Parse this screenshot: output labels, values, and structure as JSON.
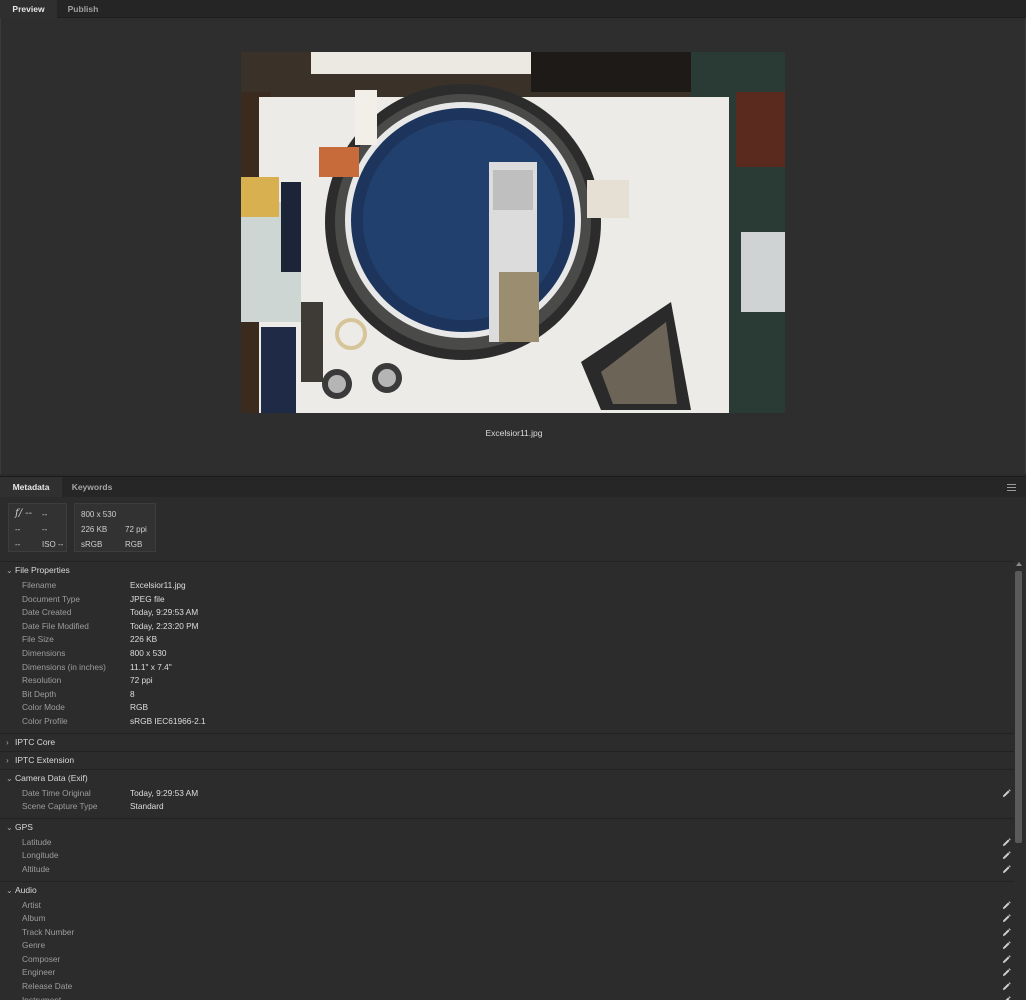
{
  "tabs": [
    {
      "label": "Preview",
      "active": true
    },
    {
      "label": "Publish",
      "active": false
    }
  ],
  "preview": {
    "caption": "Excelsior11.jpg"
  },
  "panel_tabs": [
    {
      "label": "Metadata",
      "active": true
    },
    {
      "label": "Keywords",
      "active": false
    }
  ],
  "camera_summary": {
    "aperture": "f/ --",
    "shutter": "--",
    "r2c1": "--",
    "r2c2": "--",
    "r3c1": "--",
    "iso": "ISO --"
  },
  "image_summary": {
    "dimensions": "800 x 530",
    "size": "226 KB",
    "resolution": "72 ppi",
    "profile": "sRGB",
    "mode": "RGB"
  },
  "sections": {
    "file_properties": {
      "title": "File Properties",
      "rows": [
        {
          "label": "Filename",
          "value": "Excelsior11.jpg"
        },
        {
          "label": "Document Type",
          "value": "JPEG file"
        },
        {
          "label": "Date Created",
          "value": "Today, 9:29:53 AM"
        },
        {
          "label": "Date File Modified",
          "value": "Today, 2:23:20 PM"
        },
        {
          "label": "File Size",
          "value": "226 KB"
        },
        {
          "label": "Dimensions",
          "value": "800 x 530"
        },
        {
          "label": "Dimensions (in inches)",
          "value": "11.1\" x 7.4\""
        },
        {
          "label": "Resolution",
          "value": "72 ppi"
        },
        {
          "label": "Bit Depth",
          "value": "8"
        },
        {
          "label": "Color Mode",
          "value": "RGB"
        },
        {
          "label": "Color Profile",
          "value": "sRGB IEC61966-2.1"
        }
      ]
    },
    "iptc_core": {
      "title": "IPTC Core"
    },
    "iptc_extension": {
      "title": "IPTC Extension"
    },
    "camera_data": {
      "title": "Camera Data (Exif)",
      "rows": [
        {
          "label": "Date Time Original",
          "value": "Today, 9:29:53 AM"
        },
        {
          "label": "Scene Capture Type",
          "value": "Standard"
        }
      ]
    },
    "gps": {
      "title": "GPS",
      "rows": [
        {
          "label": "Latitude",
          "value": ""
        },
        {
          "label": "Longitude",
          "value": ""
        },
        {
          "label": "Altitude",
          "value": ""
        }
      ]
    },
    "audio": {
      "title": "Audio",
      "rows": [
        {
          "label": "Artist",
          "value": ""
        },
        {
          "label": "Album",
          "value": ""
        },
        {
          "label": "Track Number",
          "value": ""
        },
        {
          "label": "Genre",
          "value": ""
        },
        {
          "label": "Composer",
          "value": ""
        },
        {
          "label": "Engineer",
          "value": ""
        },
        {
          "label": "Release Date",
          "value": ""
        },
        {
          "label": "Instrument",
          "value": ""
        }
      ]
    }
  }
}
